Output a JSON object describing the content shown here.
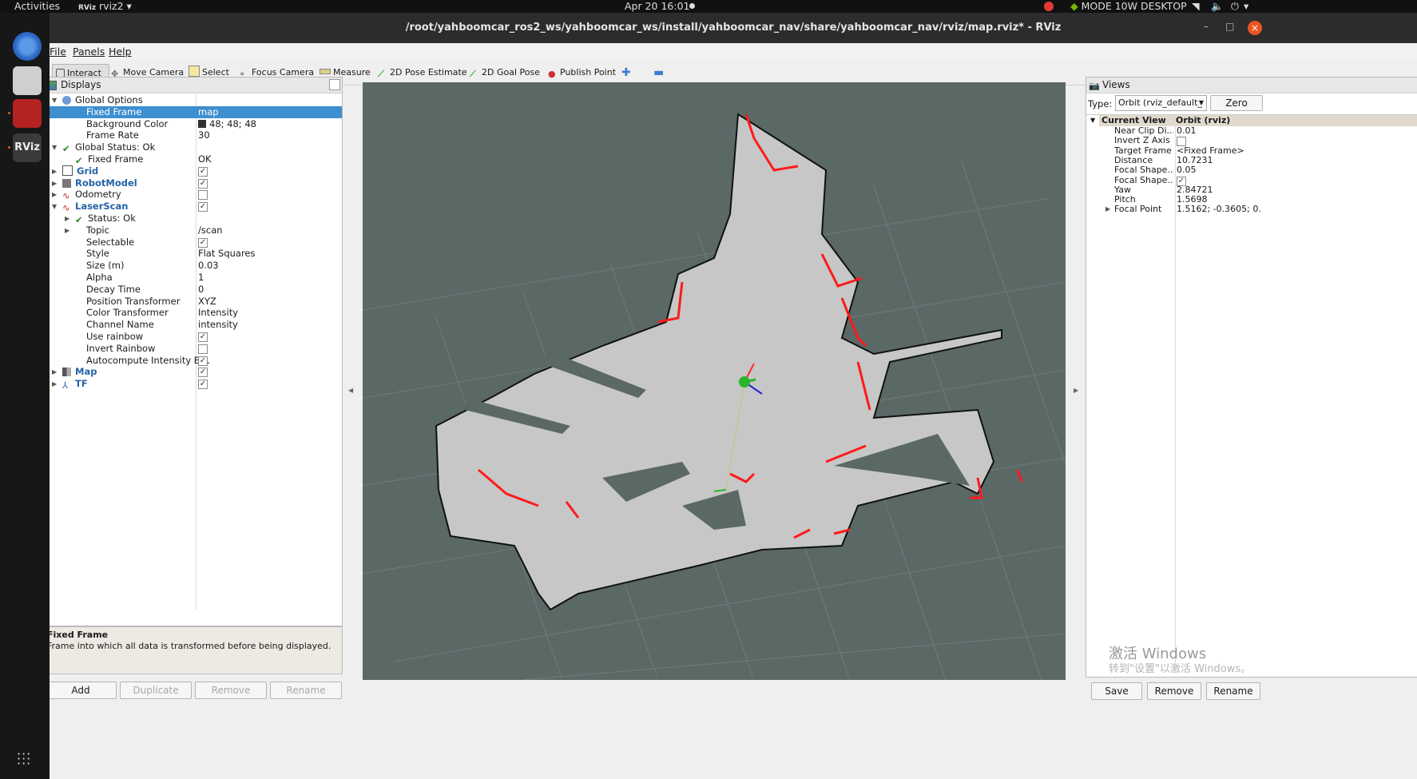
{
  "topbar": {
    "activities": "Activities",
    "app_menu": "rviz2",
    "clock": "Apr 20  16:01",
    "power_mode": "MODE 10W DESKTOP"
  },
  "window": {
    "title": "/root/yahboomcar_ros2_ws/yahboomcar_ws/install/yahboomcar_nav/share/yahboomcar_nav/rviz/map.rviz* - RViz"
  },
  "menu": {
    "items": [
      "File",
      "Panels",
      "Help"
    ]
  },
  "toolbar": {
    "tools": [
      {
        "label": "Interact",
        "icon": "cursor-icon"
      },
      {
        "label": "Move Camera",
        "icon": "move-camera-icon"
      },
      {
        "label": "Select",
        "icon": "select-icon"
      },
      {
        "label": "Focus Camera",
        "icon": "focus-camera-icon"
      },
      {
        "label": "Measure",
        "icon": "measure-icon"
      },
      {
        "label": "2D Pose Estimate",
        "icon": "pose-estimate-icon"
      },
      {
        "label": "2D Goal Pose",
        "icon": "goal-pose-icon"
      },
      {
        "label": "Publish Point",
        "icon": "publish-point-icon"
      }
    ]
  },
  "displays": {
    "title": "Displays",
    "rows": [
      {
        "label": "Global Options",
        "arrow": "open",
        "icon": "globe-icon"
      },
      {
        "label": "Fixed Frame",
        "value": "map",
        "selected": true
      },
      {
        "label": "Background Color",
        "value": "48; 48; 48",
        "swatch": "#303030"
      },
      {
        "label": "Frame Rate",
        "value": "30"
      },
      {
        "label": "Global Status: Ok",
        "arrow": "open",
        "icon": "check-icon"
      },
      {
        "label": "Fixed Frame",
        "value": "OK",
        "icon": "check-icon"
      },
      {
        "label": "Grid",
        "arrow": "closed",
        "icon": "grid-icon",
        "bold": true,
        "check": true
      },
      {
        "label": "RobotModel",
        "arrow": "closed",
        "icon": "robot-model-icon",
        "bold": true,
        "check": true
      },
      {
        "label": "Odometry",
        "arrow": "closed",
        "icon": "odometry-icon",
        "check": false
      },
      {
        "label": "LaserScan",
        "arrow": "open",
        "icon": "laserscan-icon",
        "bold": true,
        "check": true
      },
      {
        "label": "Status: Ok",
        "arrow": "closed",
        "icon": "check-icon"
      },
      {
        "label": "Topic",
        "arrow": "closed",
        "value": "/scan"
      },
      {
        "label": "Selectable",
        "check": true
      },
      {
        "label": "Style",
        "value": "Flat Squares"
      },
      {
        "label": "Size (m)",
        "value": "0.03"
      },
      {
        "label": "Alpha",
        "value": "1"
      },
      {
        "label": "Decay Time",
        "value": "0"
      },
      {
        "label": "Position Transformer",
        "value": "XYZ"
      },
      {
        "label": "Color Transformer",
        "value": "Intensity"
      },
      {
        "label": "Channel Name",
        "value": "intensity"
      },
      {
        "label": "Use rainbow",
        "check": true
      },
      {
        "label": "Invert Rainbow",
        "check": false
      },
      {
        "label": "Autocompute Intensity Boun...",
        "check": true
      },
      {
        "label": "Map",
        "arrow": "closed",
        "icon": "map-icon",
        "bold": true,
        "check": true
      },
      {
        "label": "TF",
        "arrow": "closed",
        "icon": "tf-icon",
        "bold": true,
        "check": true
      }
    ]
  },
  "description": {
    "title": "Fixed Frame",
    "text": "Frame into which all data is transformed before being displayed."
  },
  "buttons": {
    "add": "Add",
    "duplicate": "Duplicate",
    "remove": "Remove",
    "rename": "Rename"
  },
  "views": {
    "title": "Views",
    "type_label": "Type:",
    "type_value": "Orbit (rviz_default_",
    "zero": "Zero",
    "current_view": "Current View",
    "current_view_type": "Orbit (rviz)",
    "props": [
      {
        "label": "Near Clip Di...",
        "value": "0.01"
      },
      {
        "label": "Invert Z Axis",
        "check": false
      },
      {
        "label": "Target Frame",
        "value": "<Fixed Frame>"
      },
      {
        "label": "Distance",
        "value": "10.7231"
      },
      {
        "label": "Focal Shape...",
        "value": "0.05"
      },
      {
        "label": "Focal Shape...",
        "check": true
      },
      {
        "label": "Yaw",
        "value": "2.84721"
      },
      {
        "label": "Pitch",
        "value": "1.5698"
      },
      {
        "label": "Focal Point",
        "value": "1.5162; -0.3605; 0.",
        "arrow": "closed"
      }
    ],
    "save": "Save",
    "remove": "Remove",
    "rename": "Rename"
  },
  "watermark": {
    "line1": "激活 Windows",
    "line2": "转到\"设置\"以激活 Windows。"
  },
  "colors": {
    "viewport_bg": "#5a6866",
    "map_free": "#c7c7c7",
    "map_occupied": "#111111",
    "laser": "#ff1a1a",
    "selection": "#3d8fd0"
  }
}
